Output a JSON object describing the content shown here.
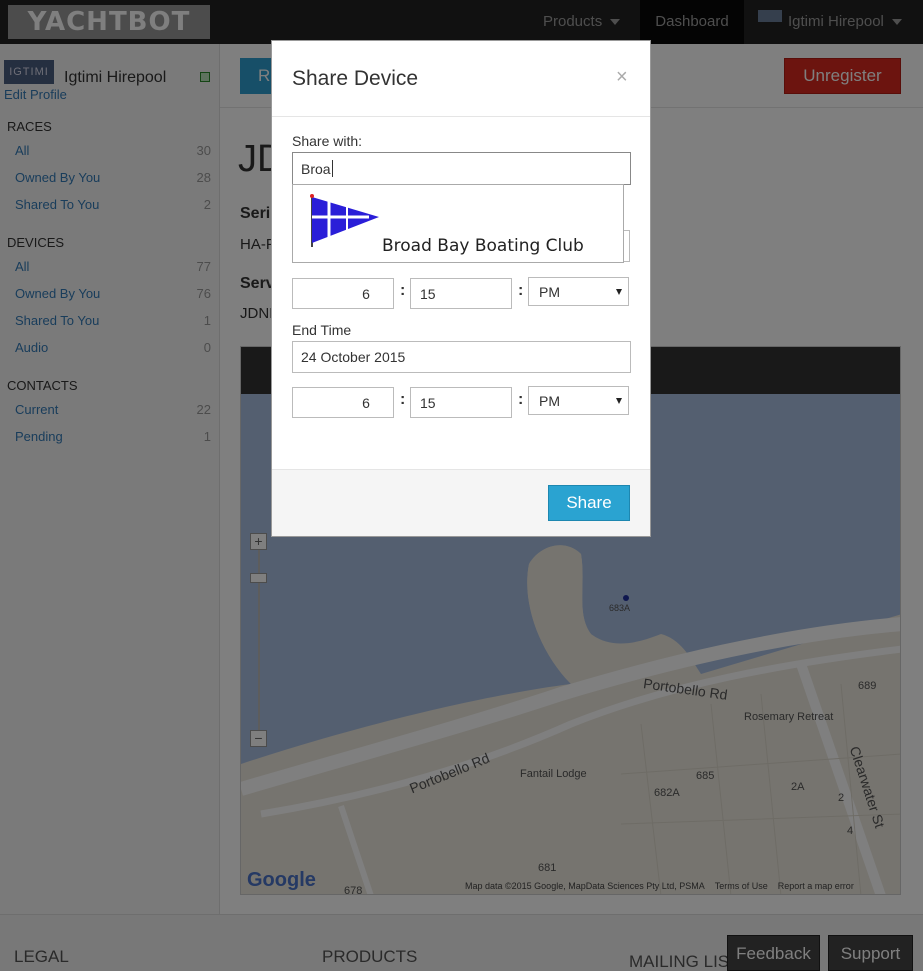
{
  "topbar": {
    "logo": "YACHTBOT",
    "products": "Products",
    "dashboard": "Dashboard",
    "user": "Igtimi Hirepool"
  },
  "sidebar": {
    "avatar_text": "IGTIMI",
    "username": "Igtimi Hirepool",
    "edit_profile": "Edit Profile",
    "sections": [
      {
        "heading": "RACES",
        "items": [
          {
            "label": "All",
            "count": "30"
          },
          {
            "label": "Owned By You",
            "count": "28"
          },
          {
            "label": "Shared To You",
            "count": "2"
          }
        ]
      },
      {
        "heading": "DEVICES",
        "items": [
          {
            "label": "All",
            "count": "77"
          },
          {
            "label": "Owned By You",
            "count": "76"
          },
          {
            "label": "Shared To You",
            "count": "1"
          },
          {
            "label": "Audio",
            "count": "0"
          }
        ]
      },
      {
        "heading": "CONTACTS",
        "items": [
          {
            "label": "Current",
            "count": "22"
          },
          {
            "label": "Pending",
            "count": "1"
          }
        ]
      }
    ]
  },
  "main": {
    "partial_button": "R",
    "unregister": "Unregister",
    "title_partial": "JD",
    "serial_label_partial": "Seri",
    "serial_value_partial": "HA-F",
    "server_label_partial": "Serv",
    "server_value_partial": "JDNI"
  },
  "map": {
    "zoom_in": "+",
    "zoom_out": "−",
    "labels": {
      "683a": "683A",
      "689": "689",
      "685": "685",
      "682a": "682A",
      "2a": "2A",
      "two": "2",
      "four": "4",
      "681": "681",
      "678": "678",
      "rosemary": "Rosemary Retreat",
      "fantail": "Fantail Lodge",
      "portobello_upper": "Portobello Rd",
      "portobello_lower": "Portobello Rd",
      "clearwater": "Clearwater St"
    },
    "google": "Google",
    "attribution": [
      "Map data ©2015 Google, MapData Sciences Pty Ltd, PSMA",
      "Terms of Use",
      "Report a map error"
    ]
  },
  "footer": {
    "legal": "LEGAL",
    "products": "PRODUCTS",
    "mailing": "MAILING LIS",
    "feedback": "Feedback",
    "support": "Support"
  },
  "modal": {
    "title": "Share Device",
    "close": "×",
    "share_with_label": "Share with:",
    "share_with_value": "Broa",
    "start_hour": "6",
    "start_minute": "15",
    "start_ampm": "PM",
    "end_time_label": "End Time",
    "end_date": "24 October 2015",
    "end_hour": "6",
    "end_minute": "15",
    "end_ampm": "PM",
    "share_button": "Share"
  },
  "autocomplete": {
    "option_name": "Broad Bay Boating Club",
    "flag_icon": "club-burgee-icon"
  },
  "colors": {
    "unregister": "#d9281f",
    "share": "#2aa3d1",
    "link": "#337ab7",
    "topbar": "#222222"
  }
}
